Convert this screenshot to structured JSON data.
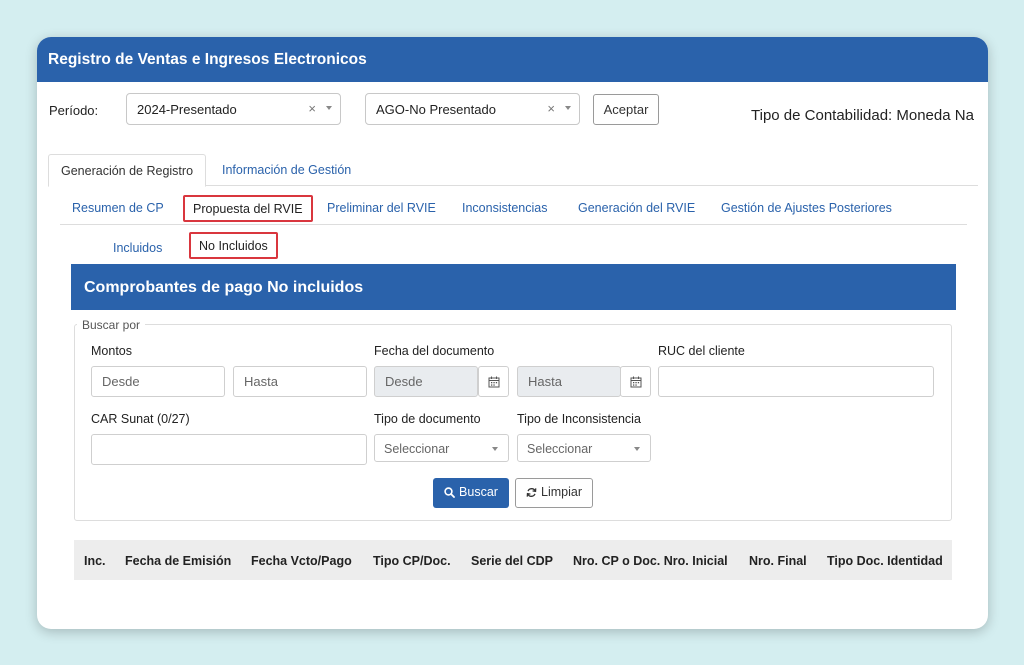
{
  "app": {
    "title": "Registro de Ventas e Ingresos Electronicos"
  },
  "period": {
    "label": "Período:",
    "year_value": "2024-Presentado",
    "month_value": "AGO-No Presentado",
    "clear_glyph": "×",
    "accept_label": "Aceptar",
    "tipo_contabilidad": "Tipo de Contabilidad: Moneda Na"
  },
  "tabs_main": [
    {
      "label": "Generación de Registro",
      "active": true
    },
    {
      "label": "Información de Gestión",
      "active": false
    }
  ],
  "tabs_sub": [
    {
      "label": "Resumen de CP",
      "active": false
    },
    {
      "label": "Propuesta del RVIE",
      "active": true
    },
    {
      "label": "Preliminar del RVIE",
      "active": false
    },
    {
      "label": "Inconsistencias",
      "active": false
    },
    {
      "label": "Generación del RVIE",
      "active": false
    },
    {
      "label": "Gestión de Ajustes Posteriores",
      "active": false
    }
  ],
  "tabs_inner": [
    {
      "label": "Incluidos",
      "active": false
    },
    {
      "label": "No Incluidos",
      "active": true
    }
  ],
  "section": {
    "title": "Comprobantes de pago No incluidos"
  },
  "search": {
    "legend": "Buscar por",
    "montos_label": "Montos",
    "desde_placeholder": "Desde",
    "hasta_placeholder": "Hasta",
    "fecha_label": "Fecha del documento",
    "fecha_desde_placeholder": "Desde",
    "fecha_hasta_placeholder": "Hasta",
    "ruc_label": "RUC del cliente",
    "car_label": "CAR Sunat (0/27)",
    "tipo_doc_label": "Tipo de documento",
    "tipo_doc_value": "Seleccionar",
    "tipo_incons_label": "Tipo de Inconsistencia",
    "tipo_incons_value": "Seleccionar",
    "buscar_label": "Buscar",
    "limpiar_label": "Limpiar"
  },
  "table": {
    "columns": [
      "Inc.",
      "Fecha de Emisión",
      "Fecha Vcto/Pago",
      "Tipo CP/Doc.",
      "Serie del CDP",
      "Nro. CP o Doc. Nro. Inicial",
      "Nro. Final",
      "Tipo Doc. Identidad"
    ]
  },
  "colors": {
    "primary": "#2a62ab",
    "highlight": "#d9363e",
    "background": "#d4eef0"
  }
}
